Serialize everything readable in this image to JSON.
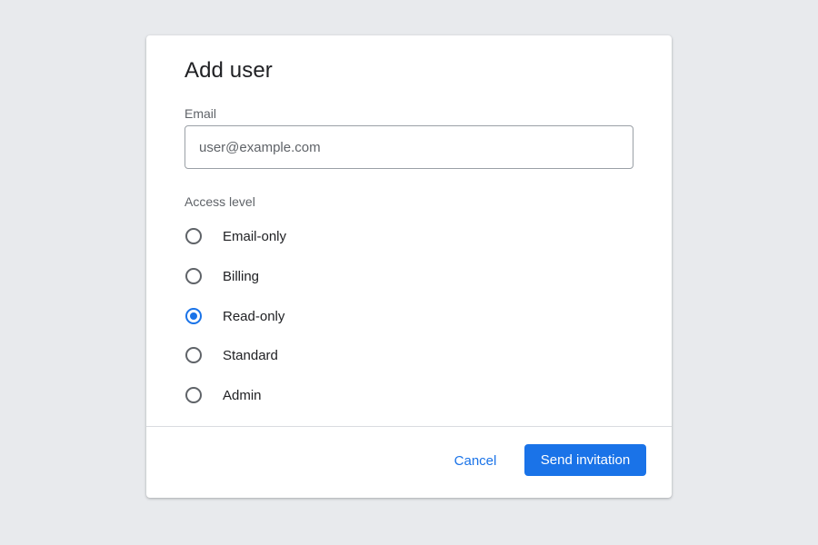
{
  "dialog": {
    "title": "Add user",
    "email": {
      "label": "Email",
      "value": "",
      "placeholder": "user@example.com"
    },
    "access": {
      "label": "Access level",
      "selected": "Read-only",
      "options": [
        {
          "label": "Email-only"
        },
        {
          "label": "Billing"
        },
        {
          "label": "Read-only"
        },
        {
          "label": "Standard"
        },
        {
          "label": "Admin"
        }
      ]
    },
    "actions": {
      "cancel_label": "Cancel",
      "submit_label": "Send invitation"
    }
  },
  "colors": {
    "accent": "#1a73e8",
    "background": "#e8eaed",
    "surface": "#ffffff",
    "divider": "#dadce0"
  }
}
